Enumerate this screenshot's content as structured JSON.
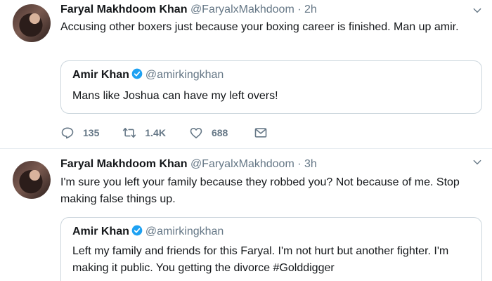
{
  "tweets": [
    {
      "author_name": "Faryal Makhdoom Khan",
      "author_handle": "@FaryalxMakhdoom",
      "time": "2h",
      "text": "Accusing other boxers just because your boxing career is finished. Man up amir.",
      "quote": {
        "author_name": "Amir Khan",
        "author_handle": "@amirkingkhan",
        "text": "Mans like Joshua can have my left overs!"
      },
      "actions": {
        "replies": "135",
        "retweets": "1.4K",
        "likes": "688"
      }
    },
    {
      "author_name": "Faryal Makhdoom Khan",
      "author_handle": "@FaryalxMakhdoom",
      "time": "3h",
      "text": "I'm sure you left your family because they robbed you? Not because of me. Stop making false things up.",
      "quote": {
        "author_name": "Amir Khan",
        "author_handle": "@amirkingkhan",
        "text": "Left my family and friends for this Faryal. I'm not hurt but another fighter. I'm making it public. You getting the divorce #Golddigger"
      }
    }
  ],
  "separator": " · ",
  "icons": {
    "reply": "reply-icon",
    "retweet": "retweet-icon",
    "like": "heart-icon",
    "dm": "envelope-icon",
    "caret": "chevron-down-icon",
    "verified": "verified-badge-icon"
  },
  "colors": {
    "text": "#14171a",
    "secondary": "#657786",
    "verified": "#1da1f2",
    "border": "#ccd6dd"
  }
}
